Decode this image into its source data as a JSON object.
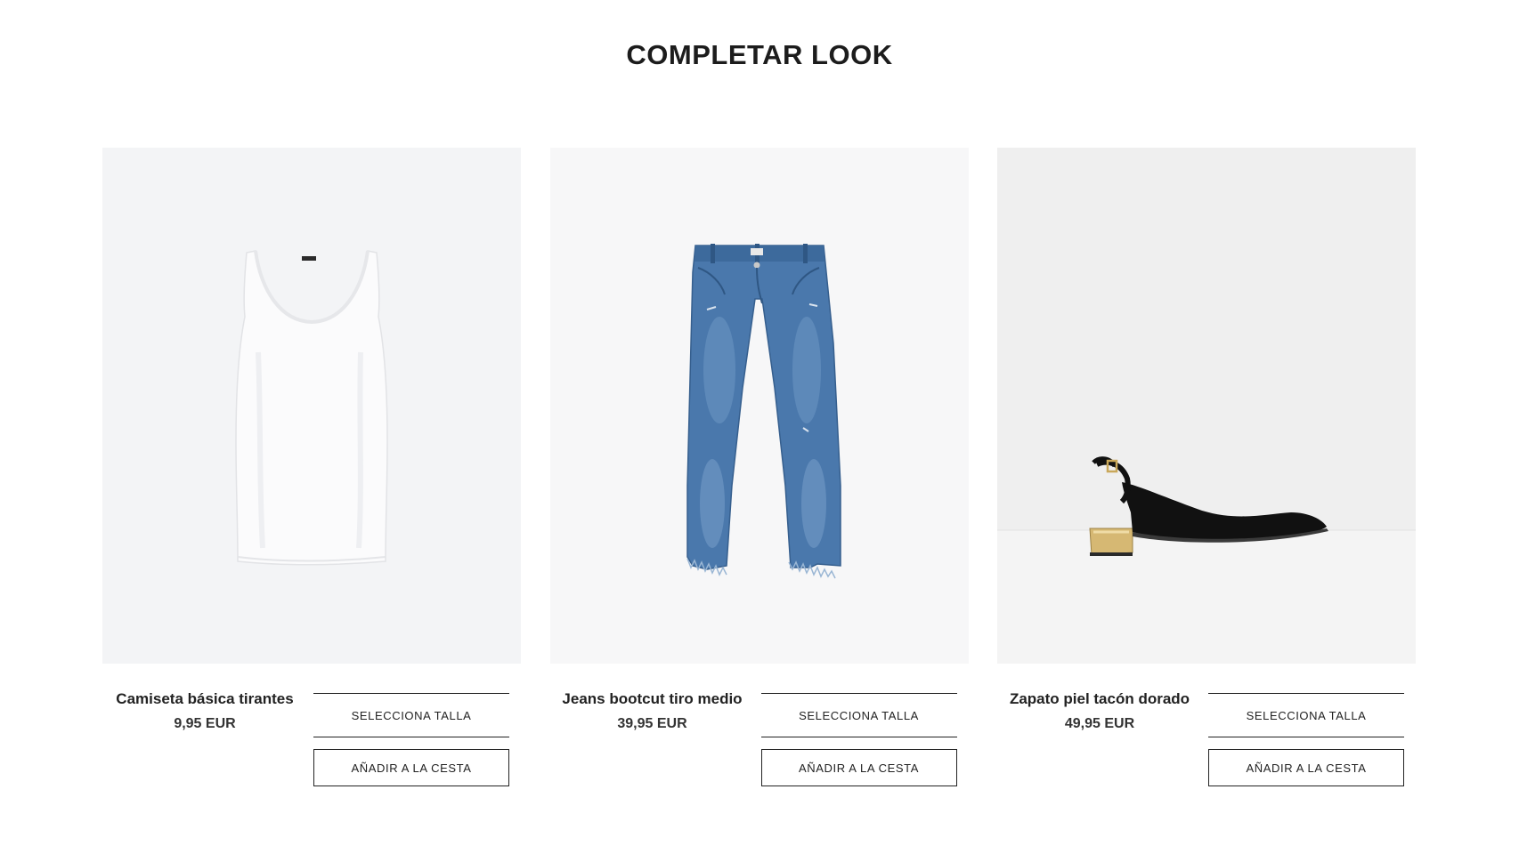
{
  "page": {
    "title": "COMPLETAR LOOK"
  },
  "products": [
    {
      "name": "Camiseta básica tirantes",
      "price": "9,95 EUR",
      "size_label": "SELECCIONA TALLA",
      "add_label": "AÑADIR A LA CESTA",
      "image_icon": "white-tank-top-image",
      "bg_color": "#f3f4f6"
    },
    {
      "name": "Jeans bootcut tiro medio",
      "price": "39,95 EUR",
      "size_label": "SELECCIONA TALLA",
      "add_label": "AÑADIR A LA CESTA",
      "image_icon": "blue-jeans-image",
      "bg_color": "#f7f7f8"
    },
    {
      "name": "Zapato piel tacón dorado",
      "price": "49,95 EUR",
      "size_label": "SELECCIONA TALLA",
      "add_label": "AÑADIR A LA CESTA",
      "image_icon": "black-slingback-shoe-image",
      "bg_color": "#efefef"
    }
  ]
}
